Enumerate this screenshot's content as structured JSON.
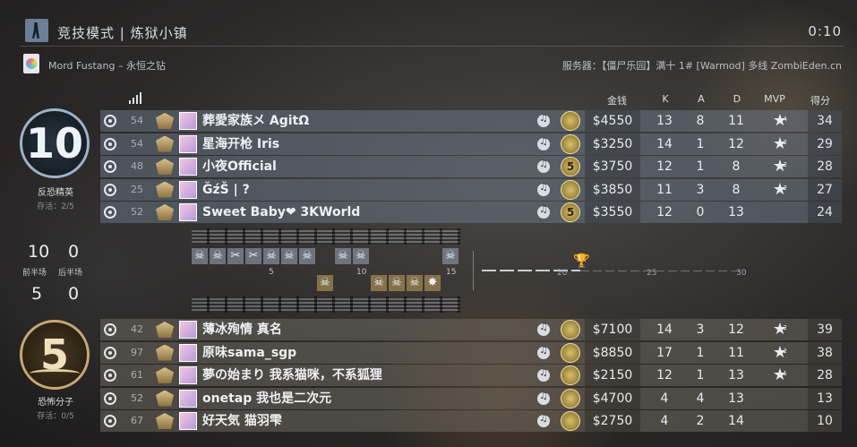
{
  "header": {
    "title": "竞技模式 | 炼狱小镇",
    "timer": "0:10"
  },
  "subheader": {
    "map_name": "Mord Fustang – 永恒之钻",
    "server": "服务器：【僵尸乐园】满十 1# [Warmod] 多线 ZombiEden.cn"
  },
  "columns": {
    "money": "金钱",
    "kills": "K",
    "assists": "A",
    "deaths": "D",
    "mvp": "MVP",
    "score": "得分"
  },
  "ct_team": {
    "score": "10",
    "name": "反恐精英",
    "alive": "存活：2/5",
    "players": [
      {
        "level": "54",
        "name": "葬愛家族メ AgitΩ",
        "coin": "",
        "money": "$4550",
        "k": "13",
        "a": "8",
        "d": "11",
        "mvp_count": "4",
        "has_mvp": true,
        "score": "34"
      },
      {
        "level": "54",
        "name": "星海开枪 Iris",
        "coin": "",
        "money": "$3250",
        "k": "14",
        "a": "1",
        "d": "12",
        "mvp_count": "2",
        "has_mvp": true,
        "score": "29"
      },
      {
        "level": "48",
        "name": "小夜Official",
        "coin": "5",
        "money": "$3750",
        "k": "12",
        "a": "1",
        "d": "8",
        "mvp_count": "2",
        "has_mvp": true,
        "score": "28"
      },
      {
        "level": "25",
        "name": "ĞźŠ | ?",
        "coin": "",
        "money": "$3850",
        "k": "11",
        "a": "3",
        "d": "8",
        "mvp_count": "2",
        "has_mvp": true,
        "score": "27"
      },
      {
        "level": "52",
        "name": "Sweet Baby❤ 3KWorld",
        "coin": "5",
        "money": "$3550",
        "k": "12",
        "a": "0",
        "d": "13",
        "mvp_count": "",
        "has_mvp": false,
        "score": "24"
      }
    ]
  },
  "halves": {
    "first_half_label": "前半场",
    "second_half_label": "后半场",
    "ct_first": "10",
    "ct_second": "0",
    "t_first": "5",
    "t_second": "0"
  },
  "round_history": {
    "marks": [
      "5",
      "10",
      "15"
    ],
    "timeline_marks": [
      "20",
      "25",
      "30"
    ]
  },
  "t_team": {
    "score": "5",
    "name": "恐怖分子",
    "alive": "存活：0/5",
    "players": [
      {
        "level": "42",
        "name": "薄冰殉情 真名",
        "money": "$7100",
        "k": "14",
        "a": "3",
        "d": "12",
        "mvp_count": "2",
        "has_mvp": true,
        "score": "39"
      },
      {
        "level": "97",
        "name": "原味sama_sgp",
        "money": "$8850",
        "k": "17",
        "a": "1",
        "d": "11",
        "mvp_count": "2",
        "has_mvp": true,
        "score": "38"
      },
      {
        "level": "61",
        "name": "夢の始まり 我系猫咪，不系狐狸",
        "money": "$2150",
        "k": "12",
        "a": "1",
        "d": "13",
        "mvp_count": "1",
        "has_mvp": true,
        "score": "28"
      },
      {
        "level": "52",
        "name": "onetap 我也是二次元",
        "money": "$4700",
        "k": "4",
        "a": "4",
        "d": "13",
        "mvp_count": "",
        "has_mvp": false,
        "score": "13"
      },
      {
        "level": "67",
        "name": "好天気 猫羽雫",
        "money": "$2750",
        "k": "4",
        "a": "2",
        "d": "14",
        "mvp_count": "",
        "has_mvp": false,
        "score": "10"
      }
    ]
  },
  "icons": {
    "mode": "counter-terrorist-icon",
    "signal": "ping-signal-icon",
    "voice": "music-note-icon",
    "mvp": "star-icon",
    "kill": "skull-icon",
    "trophy": "trophy-icon"
  }
}
